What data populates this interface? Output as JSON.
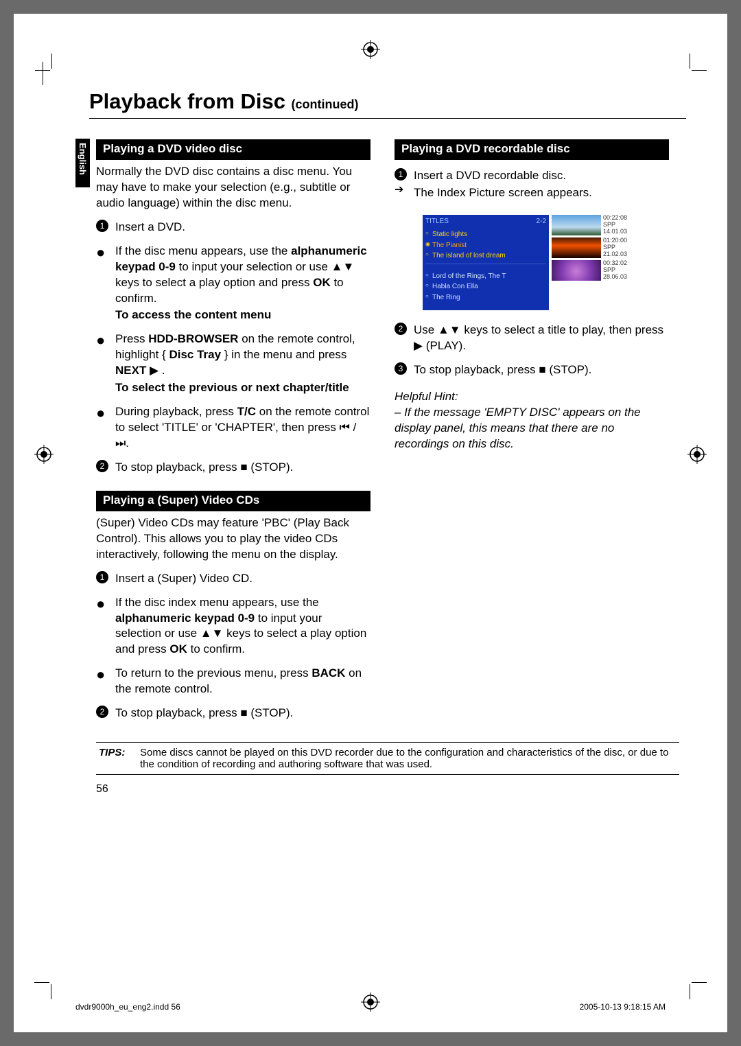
{
  "title": {
    "main": "Playback from Disc",
    "continued": "(continued)"
  },
  "language_tab": "English",
  "left": {
    "dvd_video": {
      "header": "Playing a DVD video disc",
      "intro": "Normally the DVD disc contains a disc menu. You may have to make your selection (e.g., subtitle or audio language) within the disc menu.",
      "step1": "Insert a DVD.",
      "bullet1_a": "If the disc menu appears, use the ",
      "bullet1_b": "alphanumeric keypad 0-9",
      "bullet1_c": " to input your selection or use ▲▼ keys to select a play option and press ",
      "bullet1_d": "OK",
      "bullet1_e": " to confirm.",
      "access_heading": "To access the content menu",
      "bullet2_a": "Press ",
      "bullet2_b": "HDD-BROWSER",
      "bullet2_c": " on the remote control, highlight { ",
      "bullet2_d": "Disc Tray",
      "bullet2_e": " } in the menu and press ",
      "bullet2_f": "NEXT",
      "bullet2_g": " ▶ .",
      "select_heading": "To select the previous or next chapter/title",
      "bullet3_a": "During playback, press ",
      "bullet3_b": "T/C",
      "bullet3_c": " on the remote control to select 'TITLE' or 'CHAPTER', then press ⏮ / ⏭.",
      "step2": "To stop playback, press ■ (STOP)."
    },
    "svcd": {
      "header": "Playing a (Super) Video CDs",
      "intro": "(Super) Video CDs may feature 'PBC' (Play Back Control). This allows you to play the video CDs interactively, following the menu on the display.",
      "step1": "Insert a (Super) Video CD.",
      "bullet1_a": "If the disc index menu appears, use the ",
      "bullet1_b": "alphanumeric keypad 0-9",
      "bullet1_c": " to input your selection or use ▲▼ keys to select a play option and press ",
      "bullet1_d": "OK",
      "bullet1_e": " to confirm.",
      "bullet2_a": "To return to the previous menu, press ",
      "bullet2_b": "BACK",
      "bullet2_c": " on the remote control.",
      "step2": "To stop playback, press ■ (STOP)."
    }
  },
  "right": {
    "dvd_rec": {
      "header": "Playing a DVD recordable disc",
      "step1": "Insert a DVD recordable disc.",
      "arrow_result": "The Index Picture screen appears.",
      "step2": "Use ▲▼ keys to select a title to play, then press ▶ (PLAY).",
      "step3": "To stop playback, press ■ (STOP).",
      "hint_title": "Helpful Hint:",
      "hint_body": "– If the message 'EMPTY DISC' appears on the display panel, this means that there are no recordings on this disc."
    }
  },
  "index_picture": {
    "titles_label": "TITLES",
    "page_indicator": "2-2",
    "items": [
      "Static lights",
      "The Pianist",
      "The island of lost dream",
      "Lord of the Rings, The T",
      "Habla Con Ella",
      "The Ring"
    ],
    "thumbs": [
      {
        "duration": "00:22:08",
        "mode": "SPP",
        "date": "14.01.03"
      },
      {
        "duration": "01:20:00",
        "mode": "SPP",
        "date": "21.02.03"
      },
      {
        "duration": "00:32:02",
        "mode": "SPP",
        "date": "28.06.03"
      }
    ]
  },
  "tips": {
    "label": "TIPS:",
    "text": "Some discs cannot be played on this DVD recorder due to the configuration and characteristics of the disc, or due to the condition of recording and authoring software that was used."
  },
  "page_number": "56",
  "footer": {
    "file": "dvdr9000h_eu_eng2.indd   56",
    "timestamp": "2005-10-13   9:18:15 AM"
  }
}
